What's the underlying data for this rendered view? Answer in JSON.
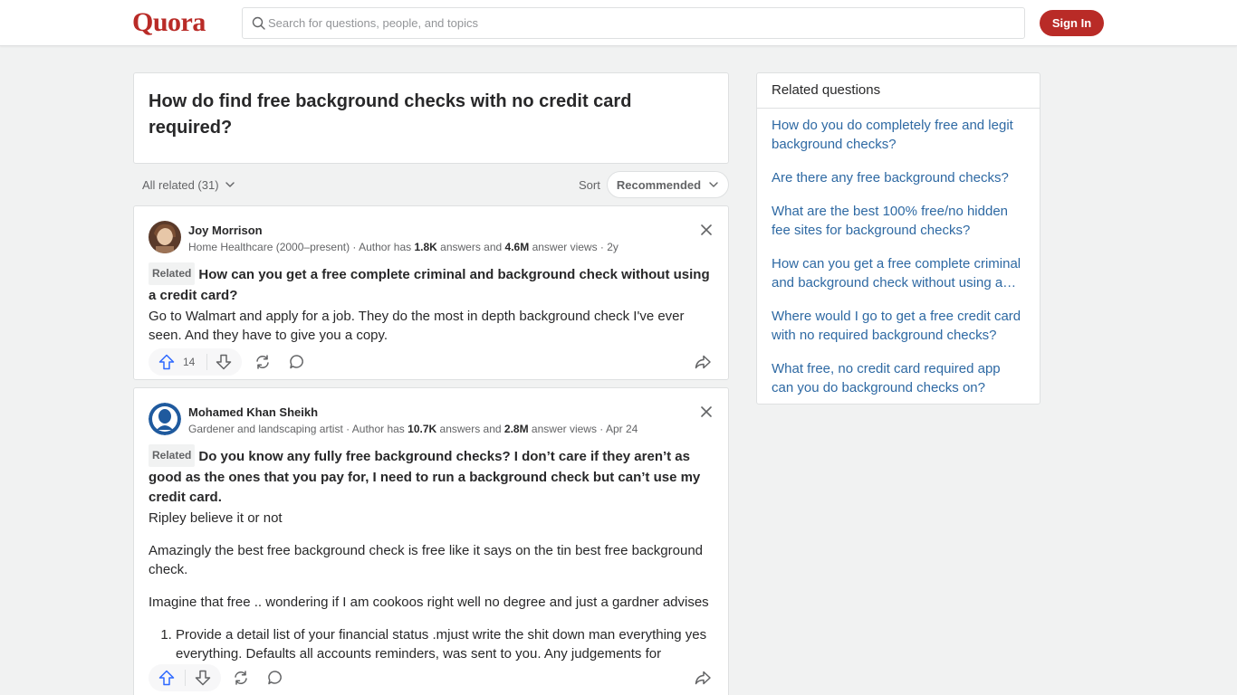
{
  "header": {
    "logo": "Quora",
    "search_placeholder": "Search for questions, people, and topics",
    "signin_label": "Sign In"
  },
  "question": {
    "title": "How do find free background checks with no credit card required?"
  },
  "filters": {
    "all_related": "All related (31)",
    "sort_label": "Sort",
    "sort_value": "Recommended"
  },
  "answers": [
    {
      "author": "Joy Morrison",
      "cred_prefix": "Home Healthcare (2000–present) · Author has ",
      "answers_count": "1.8K",
      "cred_mid": " answers and ",
      "views_count": "4.6M",
      "cred_suffix": " answer views · 2y",
      "related_tag": "Related",
      "related_title": "How can you get a free complete criminal and background check without using a credit card?",
      "body": [
        "Go to Walmart and apply for a job. They do the most in depth background check I've ever seen. And they have to give you a copy."
      ],
      "upvotes": "14"
    },
    {
      "author": "Mohamed Khan Sheikh",
      "cred_prefix": "Gardener and landscaping artist · Author has ",
      "answers_count": "10.7K",
      "cred_mid": " answers and ",
      "views_count": "2.8M",
      "cred_suffix": " answer views · Apr 24",
      "related_tag": "Related",
      "related_title": "Do you know any fully free background checks? I don’t care if they aren’t as good as the ones that you pay for, I need to run a background check but can’t use my credit card.",
      "body": [
        "Ripley believe it or not",
        "Amazingly the best free background check is free like it says on the tin best free background check.",
        "Imagine that free .. wondering if I am cookoos right well no degree and just a gardner advises"
      ],
      "list_item": "Provide a detail list of your financial status .mjust write the shit down man everything yes everything. Defaults all accounts reminders, was sent to you. Any judgements for",
      "upvotes": ""
    }
  ],
  "sidebar": {
    "title": "Related questions",
    "items": [
      "How do you do completely free and legit background checks?",
      "Are there any free background checks?",
      "What are the best 100% free/no hidden fee sites for background checks?",
      "How can you get a free complete criminal and background check without using a…",
      "Where would I go to get a free credit card with no required background checks?",
      "What free, no credit card required app can you do background checks on?"
    ]
  },
  "colors": {
    "brand": "#b92b27",
    "link": "#2e69a3",
    "upvote_active": "#2e69ff",
    "background": "#f1f2f2"
  },
  "icons": [
    "search-icon",
    "chevron-down-icon",
    "close-icon",
    "upvote-icon",
    "downvote-icon",
    "share-reshare-icon",
    "comment-icon",
    "share-arrow-icon"
  ]
}
